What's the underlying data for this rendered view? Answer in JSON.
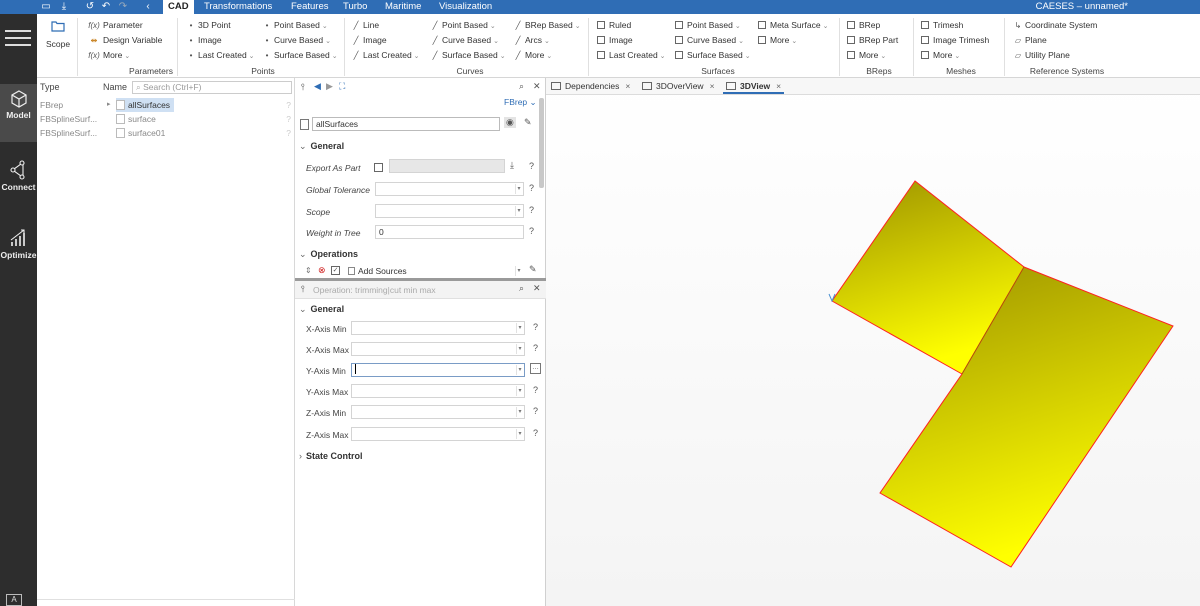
{
  "app": {
    "title": "CAESES – unnamed*",
    "menu_tabs": [
      "CAD",
      "Transformations",
      "Features",
      "Turbo",
      "Maritime",
      "Visualization"
    ]
  },
  "rail": {
    "items": [
      {
        "label": "Model",
        "icon": "cube-icon"
      },
      {
        "label": "Connect",
        "icon": "connect-icon"
      },
      {
        "label": "Optimize",
        "icon": "optimize-icon"
      }
    ],
    "bottom_label": "A"
  },
  "ribbon": {
    "scope": {
      "label": "Scope"
    },
    "parameters": {
      "label": "Parameters",
      "items": [
        "Parameter",
        "Design Variable",
        "More"
      ],
      "fx": "f(x)"
    },
    "points": {
      "label": "Points",
      "col1": [
        "3D Point",
        "Image",
        "Last Created"
      ],
      "col2": [
        "Point Based",
        "Curve Based",
        "Surface Based"
      ]
    },
    "curves": {
      "label": "Curves",
      "col1": [
        "Line",
        "Image",
        "Last Created"
      ],
      "col2": [
        "Point Based",
        "Curve Based",
        "Surface Based"
      ],
      "col3": [
        "BRep Based",
        "Arcs",
        "More"
      ]
    },
    "surfaces": {
      "label": "Surfaces",
      "col1": [
        "Ruled",
        "Image",
        "Last Created"
      ],
      "col2": [
        "Point Based",
        "Curve Based",
        "Surface Based"
      ],
      "col3": [
        "Meta Surface",
        "More"
      ]
    },
    "breps": {
      "label": "BReps",
      "items": [
        "BRep",
        "BRep Part",
        "More"
      ]
    },
    "meshes": {
      "label": "Meshes",
      "items": [
        "Trimesh",
        "Image Trimesh",
        "More"
      ]
    },
    "refsys": {
      "label": "Reference Systems",
      "items": [
        "Coordinate System",
        "Plane",
        "Utility Plane"
      ]
    }
  },
  "tree": {
    "col_type": "Type",
    "col_name": "Name",
    "search_placeholder": "Search (Ctrl+F)",
    "rows": [
      {
        "type": "FBrep",
        "name": "allSurfaces",
        "selected": true
      },
      {
        "type": "FBSplineSurf...",
        "name": "surface",
        "selected": false
      },
      {
        "type": "FBSplineSurf...",
        "name": "surface01",
        "selected": false
      }
    ]
  },
  "props": {
    "type_label": "FBrep",
    "object_name": "allSurfaces",
    "general_label": "General",
    "fields": [
      {
        "label": "Export As Part",
        "value": ""
      },
      {
        "label": "Global Tolerance",
        "value": ""
      },
      {
        "label": "Scope",
        "value": ""
      },
      {
        "label": "Weight in Tree",
        "value": "0"
      }
    ],
    "operations_label": "Operations",
    "add_sources": "Add Sources",
    "operation_title": "Operation: trimming|cut min max",
    "op_general_label": "General",
    "op_fields": [
      {
        "label": "X-Axis Min",
        "value": ""
      },
      {
        "label": "X-Axis Max",
        "value": ""
      },
      {
        "label": "Y-Axis Min",
        "value": ""
      },
      {
        "label": "Y-Axis Max",
        "value": ""
      },
      {
        "label": "Z-Axis Min",
        "value": ""
      },
      {
        "label": "Z-Axis Max",
        "value": ""
      }
    ],
    "state_control_label": "State Control",
    "help": "?"
  },
  "viewport": {
    "tabs": [
      {
        "label": "Dependencies",
        "active": false
      },
      {
        "label": "3DOverView",
        "active": false
      },
      {
        "label": "3DView",
        "active": true
      }
    ],
    "surface_colors": {
      "dark": "#9c9200",
      "light": "#ffff00",
      "edge": "#ff2020"
    }
  }
}
